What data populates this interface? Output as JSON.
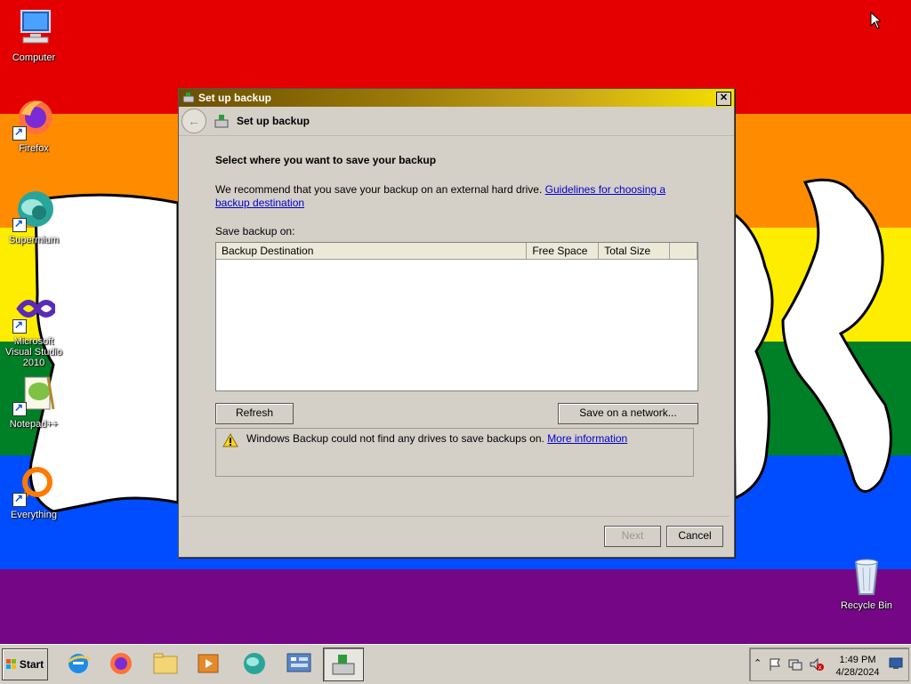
{
  "desktop": {
    "icons": [
      {
        "label": "Computer"
      },
      {
        "label": "Firefox"
      },
      {
        "label": "Supermium"
      },
      {
        "label": "Microsoft Visual Studio 2010"
      },
      {
        "label": "Notepad++"
      },
      {
        "label": "Everything"
      },
      {
        "label": "Recycle Bin"
      }
    ]
  },
  "dialog": {
    "title": "Set up backup",
    "close_glyph": "✕",
    "nav_title": "Set up backup",
    "heading": "Select where you want to save your backup",
    "recommend_text": "We recommend that you save your backup on an external hard drive. ",
    "guidelines_link": "Guidelines for choosing a backup destination",
    "save_label": "Save backup on:",
    "table": {
      "columns": [
        "Backup Destination",
        "Free Space",
        "Total Size",
        ""
      ],
      "rows": []
    },
    "refresh_button": "Refresh",
    "save_network_button": "Save on a network...",
    "warning_text": "Windows Backup could not find any drives to save backups on. ",
    "more_info_link": "More information",
    "next_button": "Next",
    "cancel_button": "Cancel"
  },
  "taskbar": {
    "start_label": "Start",
    "pinned": [
      "internet-explorer-icon",
      "firefox-icon",
      "file-explorer-icon",
      "media-player-icon",
      "supermium-icon",
      "control-panel-icon",
      "backup-icon"
    ],
    "clock_time": "1:49 PM",
    "clock_date": "4/28/2024"
  }
}
